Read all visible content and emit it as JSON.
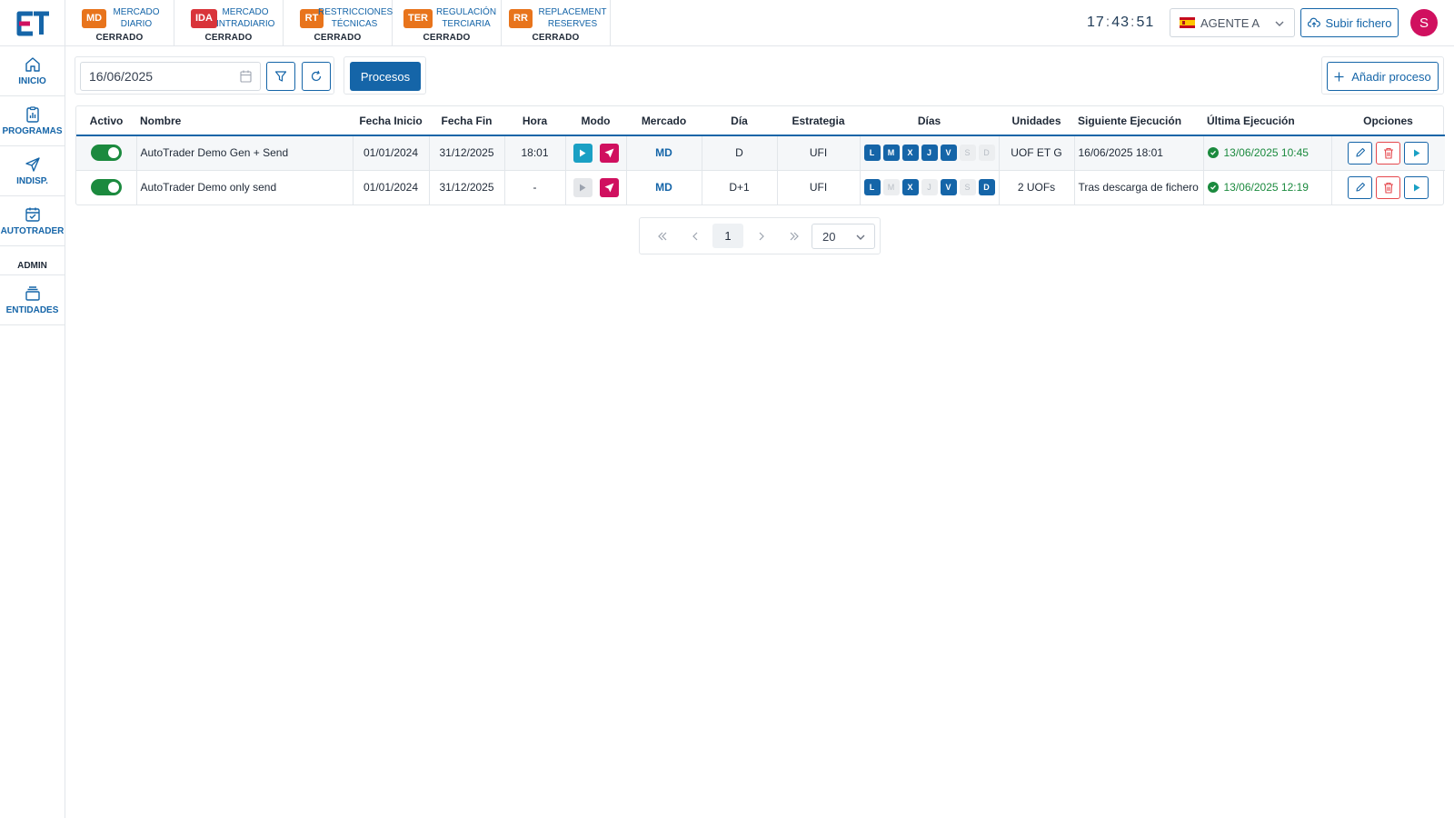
{
  "app": {
    "logo_text": "ET"
  },
  "markets": [
    {
      "code": "MD",
      "name_line1": "MERCADO",
      "name_line2": "DIARIO",
      "state": "CERRADO",
      "color": "#e8741c"
    },
    {
      "code": "IDA",
      "name_line1": "MERCADO",
      "name_line2": "INTRADIARIO",
      "state": "CERRADO",
      "color": "#d9343a"
    },
    {
      "code": "RT",
      "name_line1": "RESTRICCIONES",
      "name_line2": "TÉCNICAS",
      "state": "CERRADO",
      "color": "#e8741c"
    },
    {
      "code": "TER",
      "name_line1": "REGULACIÓN",
      "name_line2": "TERCIARIA",
      "state": "CERRADO",
      "color": "#e8741c"
    },
    {
      "code": "RR",
      "name_line1": "REPLACEMENT",
      "name_line2": "RESERVES",
      "state": "CERRADO",
      "color": "#e8741c"
    }
  ],
  "header": {
    "clock": {
      "h": "17",
      "m": "43",
      "s": "51"
    },
    "agent": "AGENTE A",
    "upload_label": "Subir fichero",
    "avatar_initial": "S"
  },
  "sidebar": {
    "items": [
      {
        "label": "INICIO",
        "icon": "home-icon"
      },
      {
        "label": "PROGRAMAS",
        "icon": "chart-clipboard-icon"
      },
      {
        "label": "INDISP.",
        "icon": "send-icon"
      },
      {
        "label": "AUTOTRADER",
        "icon": "calendar-check-icon"
      }
    ],
    "section": "ADMIN",
    "admin_items": [
      {
        "label": "ENTIDADES",
        "icon": "stack-icon"
      }
    ]
  },
  "toolbar": {
    "date_value": "16/06/2025",
    "processes_label": "Procesos",
    "add_label": "Añadir proceso"
  },
  "table": {
    "columns": [
      "Activo",
      "Nombre",
      "Fecha Inicio",
      "Fecha Fin",
      "Hora",
      "Modo",
      "Mercado",
      "Día",
      "Estrategia",
      "Días",
      "Unidades",
      "Siguiente Ejecución",
      "Última Ejecución",
      "Opciones"
    ],
    "rows": [
      {
        "active": true,
        "name": "AutoTrader Demo Gen + Send",
        "start": "01/01/2024",
        "end": "31/12/2025",
        "hour": "18:01",
        "mode_generate": true,
        "mode_send": true,
        "market": "MD",
        "day": "D",
        "strategy": "UFI",
        "days": [
          {
            "l": "L",
            "on": true
          },
          {
            "l": "M",
            "on": true
          },
          {
            "l": "X",
            "on": true
          },
          {
            "l": "J",
            "on": true
          },
          {
            "l": "V",
            "on": true
          },
          {
            "l": "S",
            "on": false
          },
          {
            "l": "D",
            "on": false
          }
        ],
        "units": "UOF ET G",
        "next": "16/06/2025 18:01",
        "last": "13/06/2025 10:45"
      },
      {
        "active": true,
        "name": "AutoTrader Demo only send",
        "start": "01/01/2024",
        "end": "31/12/2025",
        "hour": "-",
        "mode_generate": false,
        "mode_send": true,
        "market": "MD",
        "day": "D+1",
        "strategy": "UFI",
        "days": [
          {
            "l": "L",
            "on": true
          },
          {
            "l": "M",
            "on": false
          },
          {
            "l": "X",
            "on": true
          },
          {
            "l": "J",
            "on": false
          },
          {
            "l": "V",
            "on": true
          },
          {
            "l": "S",
            "on": false
          },
          {
            "l": "D",
            "on": true
          }
        ],
        "units": "2 UOFs",
        "next": "Tras descarga de fichero",
        "last": "13/06/2025 12:19"
      }
    ]
  },
  "pagination": {
    "current_page": "1",
    "rows_per_page": "20"
  },
  "colors": {
    "primary": "#1565a8",
    "success": "#1b8a3e",
    "danger": "#e5484d",
    "accent_pink": "#d0105f",
    "mode_play": "#1aa0c4"
  }
}
